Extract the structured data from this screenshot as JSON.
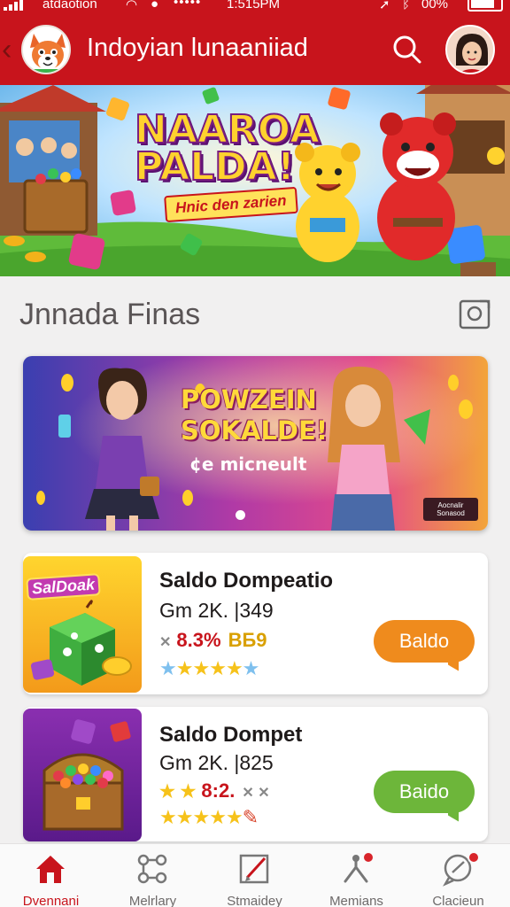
{
  "status_bar": {
    "carrier": "atdaotion",
    "time": "1:515PM",
    "battery": "00%"
  },
  "header": {
    "title": "Indoyian lunaaniiad",
    "icons": [
      "back-arrow-icon",
      "fox-mascot-logo",
      "search-icon",
      "user-avatar"
    ]
  },
  "hero": {
    "headline_1": "NAAROA",
    "headline_2": "PALDA!",
    "tagline": "Hnic den zarien"
  },
  "section": {
    "title": "Jnnada Finas",
    "icon": "image-frame-icon"
  },
  "promo": {
    "headline": [
      "POWZEIN",
      "SOKALDE!"
    ],
    "subtitle": "¢e micneult",
    "tag": [
      "Aocnalir",
      "Sonasod"
    ]
  },
  "games": [
    {
      "title": "Saldo Dompeatio",
      "subtitle": "Gm 2K. |349",
      "rate_prefix": "✕",
      "rate": "8.3%",
      "rate_code": "BБ9",
      "thumb_label": "SalDoak",
      "rating": 5,
      "button_label": "Baldo",
      "button_color": "#ef8b1d"
    },
    {
      "title": "Saldo Dompet",
      "subtitle": "Gm 2K. |825",
      "rate_prefix": "★ ★",
      "rate": "8:2.",
      "rate_code": "✕ ✕",
      "rating": 5,
      "button_label": "Baido",
      "button_color": "#6db63a"
    }
  ],
  "bottom_nav": [
    {
      "label": "Dvennani",
      "icon": "home-icon",
      "active": true
    },
    {
      "label": "Melrlary",
      "icon": "nodes-icon",
      "active": false
    },
    {
      "label": "Stmaidey",
      "icon": "edit-icon",
      "active": false
    },
    {
      "label": "Memians",
      "icon": "tree-icon",
      "active": false,
      "badge": true
    },
    {
      "label": "Clacieun",
      "icon": "chat-icon",
      "active": false,
      "badge": true
    }
  ],
  "colors": {
    "brand_red": "#c8141c",
    "background": "#f1f0f0",
    "orange_button": "#ef8b1d",
    "green_button": "#6db63a"
  }
}
